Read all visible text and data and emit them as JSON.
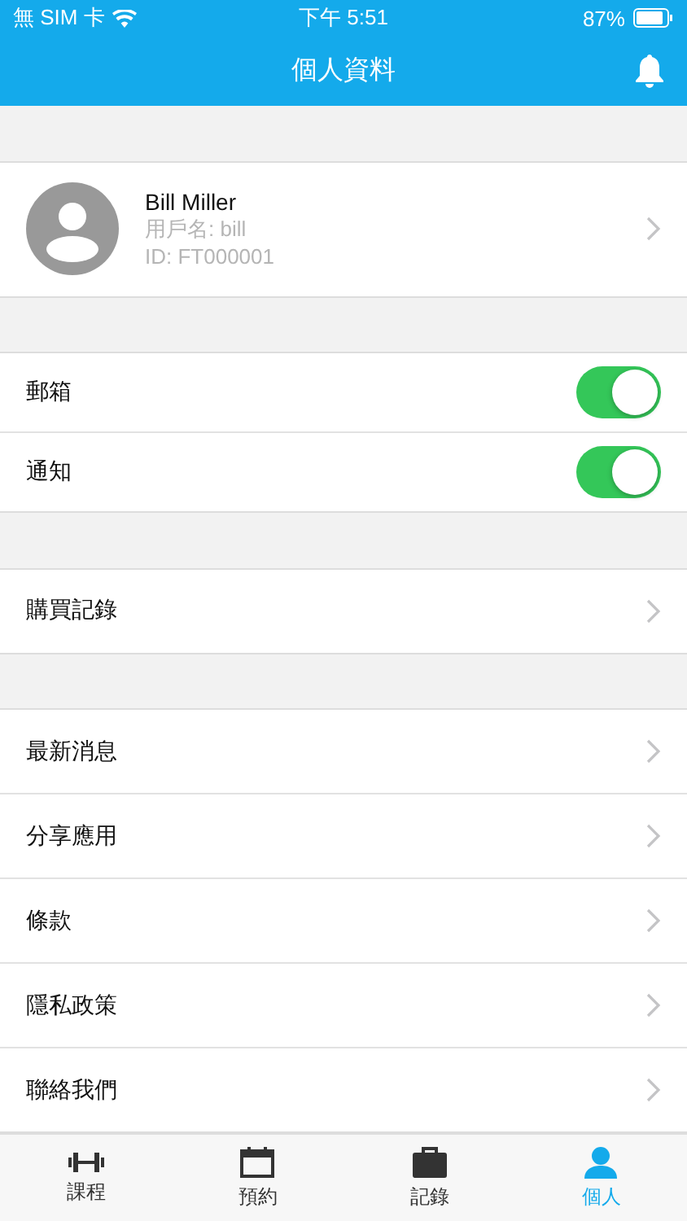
{
  "status_bar": {
    "carrier": "無 SIM 卡",
    "time": "下午 5:51",
    "battery": "87%"
  },
  "nav": {
    "title": "個人資料"
  },
  "profile": {
    "name": "Bill Miller",
    "username": "用戶名: bill",
    "id": "ID: FT000001"
  },
  "sections": [
    [
      {
        "kind": "toggle",
        "label": "郵箱",
        "on": true
      },
      {
        "kind": "toggle",
        "label": "通知",
        "on": true
      }
    ],
    [
      {
        "kind": "link",
        "label": "購買記錄"
      }
    ],
    [
      {
        "kind": "link",
        "label": "最新消息"
      },
      {
        "kind": "link",
        "label": "分享應用"
      },
      {
        "kind": "link",
        "label": "條款"
      },
      {
        "kind": "link",
        "label": "隱私政策"
      },
      {
        "kind": "link",
        "label": "聯絡我們"
      }
    ]
  ],
  "tabs": [
    {
      "kind": "dumbbell",
      "label": "課程",
      "selected": false
    },
    {
      "kind": "calendar",
      "label": "預約",
      "selected": false
    },
    {
      "kind": "briefcase",
      "label": "記錄",
      "selected": false
    },
    {
      "kind": "person",
      "label": "個人",
      "selected": true
    }
  ]
}
